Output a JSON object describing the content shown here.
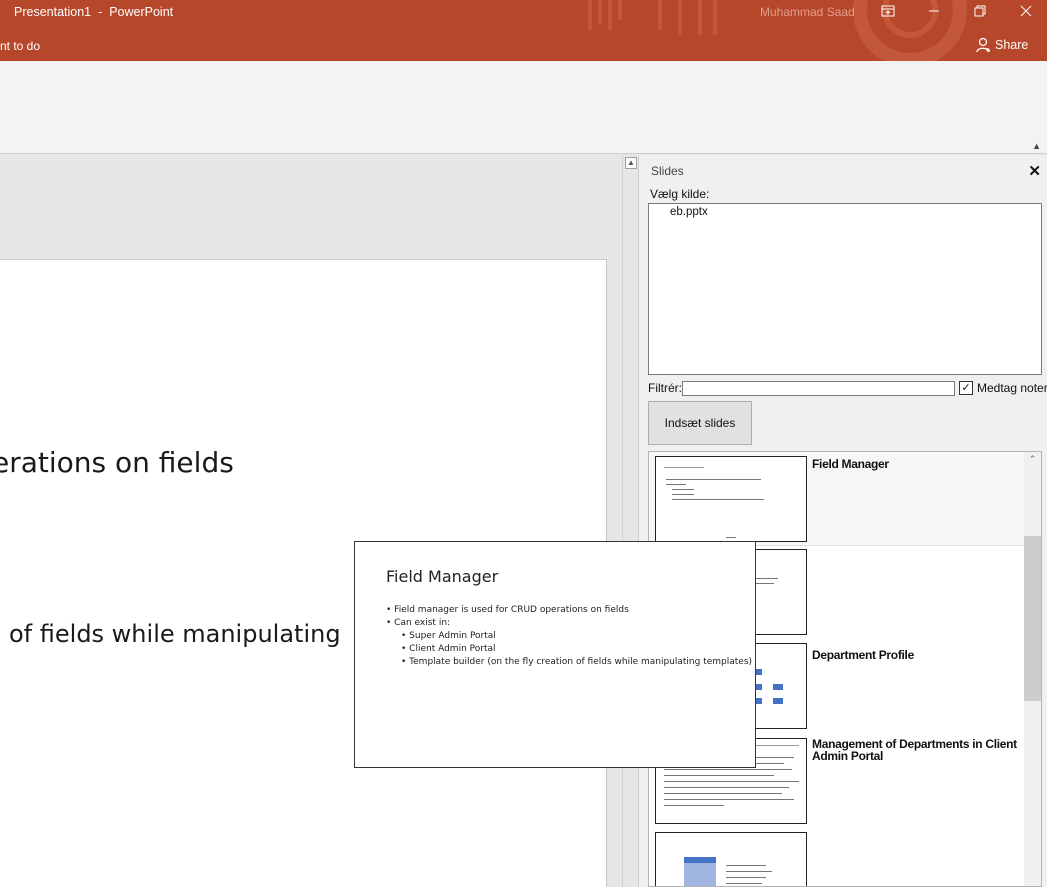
{
  "window": {
    "title": "Presentation1  -  PowerPoint",
    "user": "Muhammad Saad",
    "tell_me": "nt to do",
    "share_label": "Share"
  },
  "editor": {
    "slide_text_1": "erations on fields",
    "slide_text_2": "of fields while manipulating"
  },
  "pane": {
    "title": "Slides",
    "source_label": "Vælg kilde:",
    "source_items": [
      "eb.pptx"
    ],
    "filter_label": "Filtrér:",
    "filter_value": "",
    "include_notes_label": "Medtag noter",
    "include_notes_checked": true,
    "insert_button_label": "Indsæt slides",
    "slides": [
      {
        "title": "Field Manager",
        "selected": true
      },
      {
        "title": "",
        "selected": false
      },
      {
        "title": "Department Profile",
        "selected": false
      },
      {
        "title": "Management of Departments in Client Admin Portal",
        "selected": false
      },
      {
        "title": "",
        "selected": false
      }
    ]
  },
  "preview": {
    "title": "Field Manager",
    "bullets": [
      {
        "level": 1,
        "text": "• Field manager is used for CRUD operations on fields"
      },
      {
        "level": 1,
        "text": "• Can exist in:"
      },
      {
        "level": 2,
        "text": "• Super Admin Portal"
      },
      {
        "level": 2,
        "text": "• Client Admin Portal"
      },
      {
        "level": 2,
        "text": "• Template builder (on the fly creation of fields while manipulating templates)"
      }
    ]
  },
  "colors": {
    "titlebar": "#b7472a",
    "thumb_accent": "#4472c4"
  }
}
